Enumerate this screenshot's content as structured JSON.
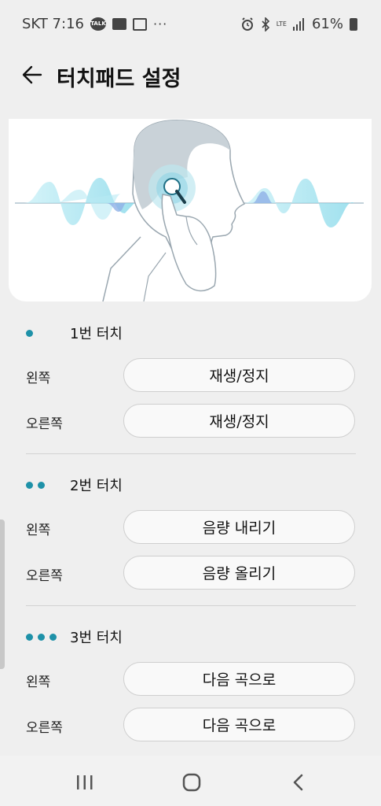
{
  "status": {
    "carrier_time": "SKT 7:16",
    "network": "LTE",
    "battery": "61%",
    "icons": [
      "kakaotalk-icon",
      "message-icon",
      "gallery-icon",
      "more-dots-icon",
      "alarm-icon",
      "bluetooth-icon",
      "lte-icon",
      "signal-icon",
      "battery-icon"
    ]
  },
  "header": {
    "title": "터치패드 설정",
    "back_icon": "arrow-left-icon"
  },
  "groups": [
    {
      "title": "1번 터치",
      "dots": 1,
      "rows": [
        {
          "side": "왼쪽",
          "action": "재생/정지"
        },
        {
          "side": "오른쪽",
          "action": "재생/정지"
        }
      ]
    },
    {
      "title": "2번 터치",
      "dots": 2,
      "rows": [
        {
          "side": "왼쪽",
          "action": "음량 내리기"
        },
        {
          "side": "오른쪽",
          "action": "음량 올리기"
        }
      ]
    },
    {
      "title": "3번 터치",
      "dots": 3,
      "rows": [
        {
          "side": "왼쪽",
          "action": "다음 곡으로"
        },
        {
          "side": "오른쪽",
          "action": "다음 곡으로"
        }
      ]
    }
  ],
  "colors": {
    "accent": "#1e91a8",
    "background": "#efefef",
    "wave_light": "#aee6f2",
    "wave_blue": "#8fb0e6"
  },
  "navbar": {
    "icons": [
      "recent-apps-icon",
      "home-icon",
      "back-icon"
    ]
  }
}
